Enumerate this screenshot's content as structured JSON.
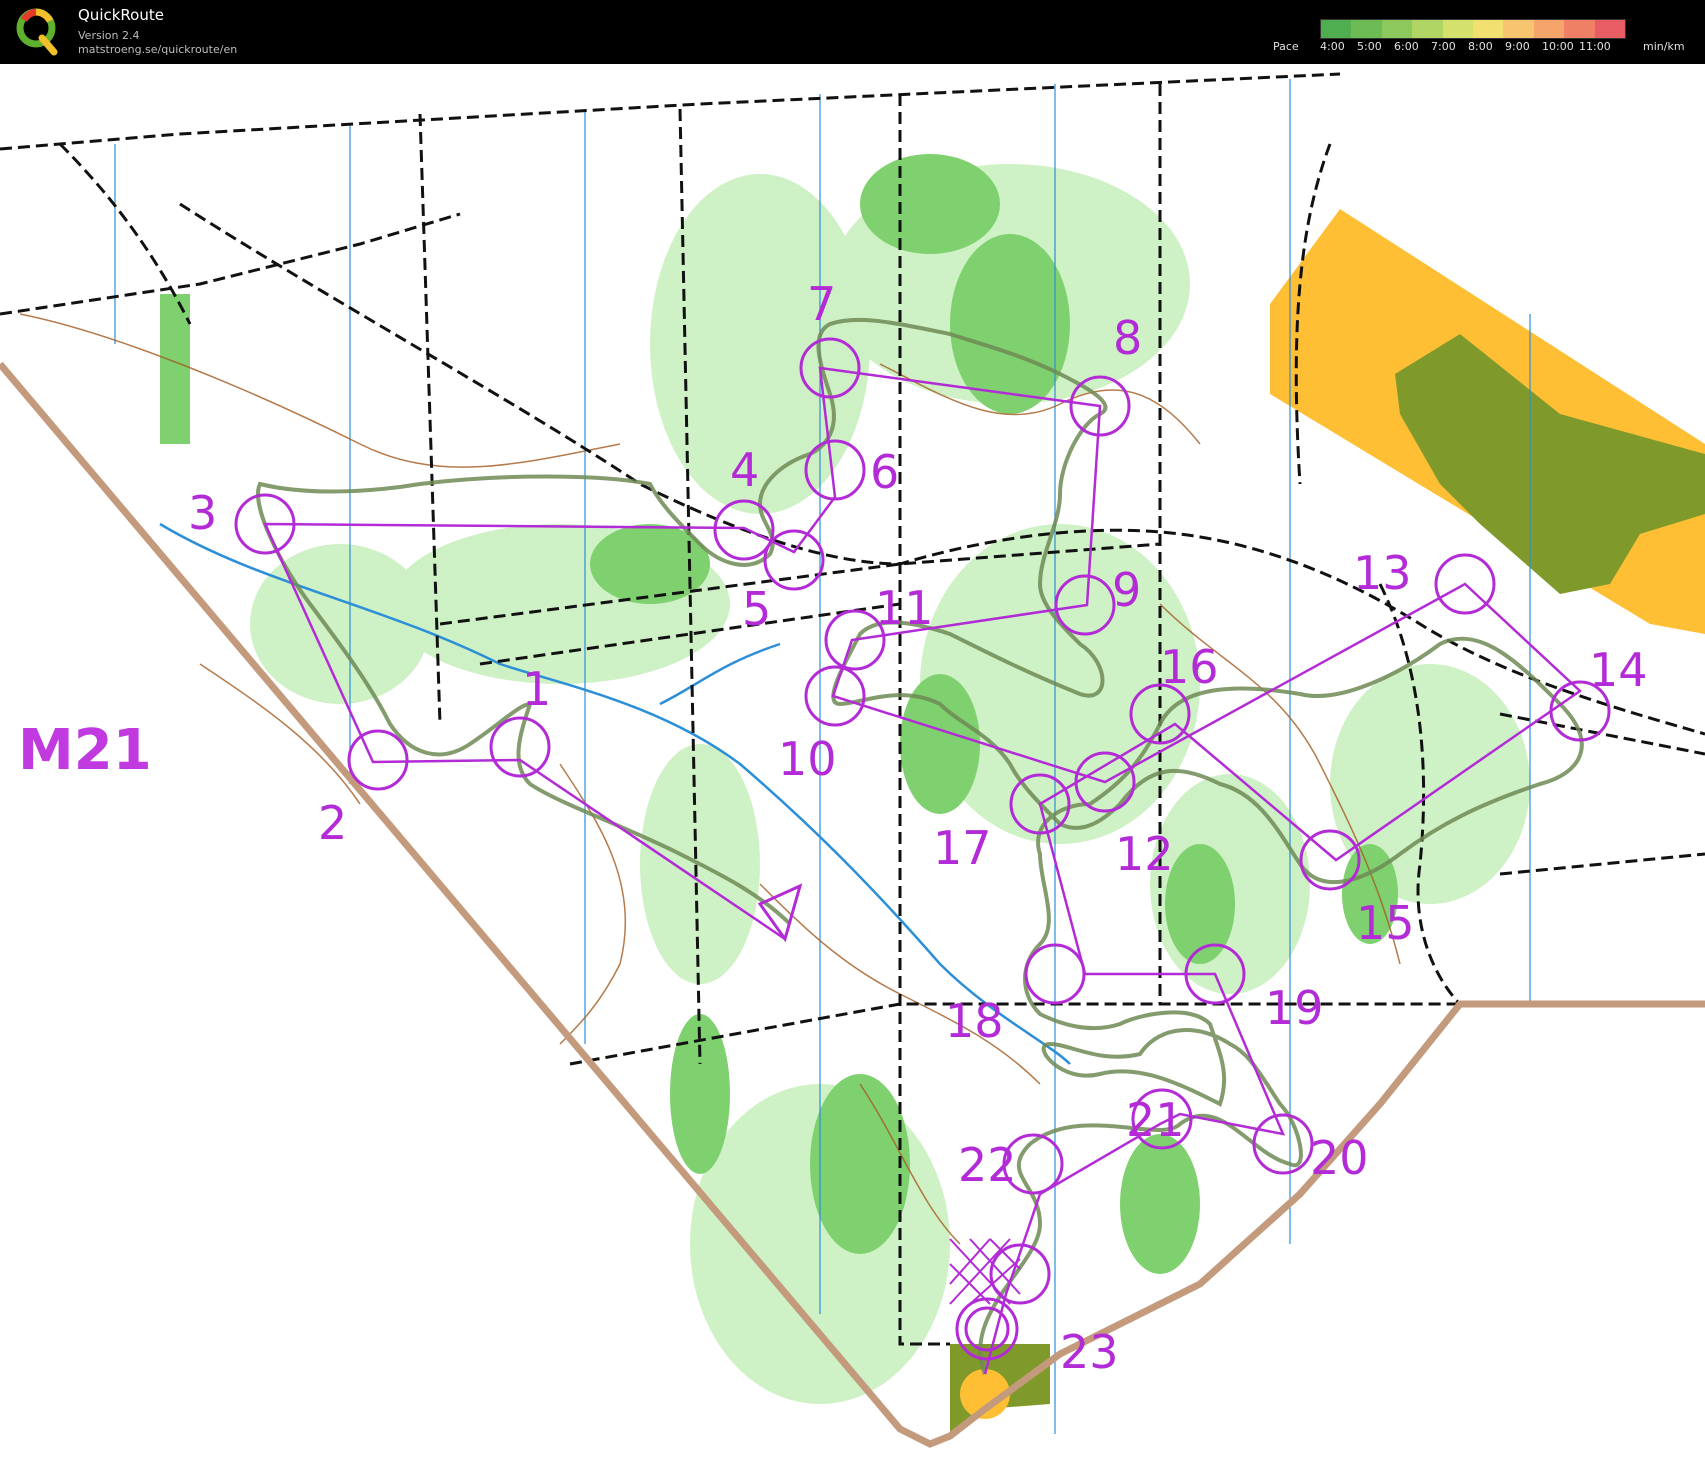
{
  "app": {
    "title": "QuickRoute",
    "version": "Version 2.4",
    "url": "matstroeng.se/quickroute/en"
  },
  "pace_legend": {
    "label": "Pace",
    "unit": "min/km",
    "ticks": [
      "4:00",
      "5:00",
      "6:00",
      "7:00",
      "8:00",
      "9:00",
      "10:00",
      "11:00"
    ],
    "colors": [
      "#4fae4f",
      "#6cbb55",
      "#8dc85d",
      "#b0d564",
      "#d4e16c",
      "#f2e071",
      "#f7c56f",
      "#f5a46a",
      "#ef8066",
      "#e85d63"
    ]
  },
  "map": {
    "course_name": "M21",
    "controls": [
      {
        "id": "start",
        "label": ""
      },
      {
        "id": "1",
        "label": "1"
      },
      {
        "id": "2",
        "label": "2"
      },
      {
        "id": "3",
        "label": "3"
      },
      {
        "id": "4",
        "label": "4"
      },
      {
        "id": "5",
        "label": "5"
      },
      {
        "id": "6",
        "label": "6"
      },
      {
        "id": "7",
        "label": "7"
      },
      {
        "id": "8",
        "label": "8"
      },
      {
        "id": "9",
        "label": "9"
      },
      {
        "id": "10",
        "label": "10"
      },
      {
        "id": "11",
        "label": "11"
      },
      {
        "id": "12",
        "label": "12"
      },
      {
        "id": "13",
        "label": "13"
      },
      {
        "id": "14",
        "label": "14"
      },
      {
        "id": "15",
        "label": "15"
      },
      {
        "id": "16",
        "label": "16"
      },
      {
        "id": "17",
        "label": "17"
      },
      {
        "id": "18",
        "label": "18"
      },
      {
        "id": "19",
        "label": "19"
      },
      {
        "id": "20",
        "label": "20"
      },
      {
        "id": "21",
        "label": "21"
      },
      {
        "id": "22",
        "label": "22"
      },
      {
        "id": "23",
        "label": "23"
      },
      {
        "id": "finish",
        "label": ""
      }
    ],
    "colors": {
      "course": "#b32bd6",
      "route": "#6e8a55",
      "vegetation": "#7fd16f",
      "light_vegetation": "#c9efbf",
      "open_land": "#ffbf35",
      "dark_green": "#7f9a2b",
      "contour": "#a35a1f",
      "water": "#2c8fd8",
      "border": "#c49a7d"
    }
  }
}
